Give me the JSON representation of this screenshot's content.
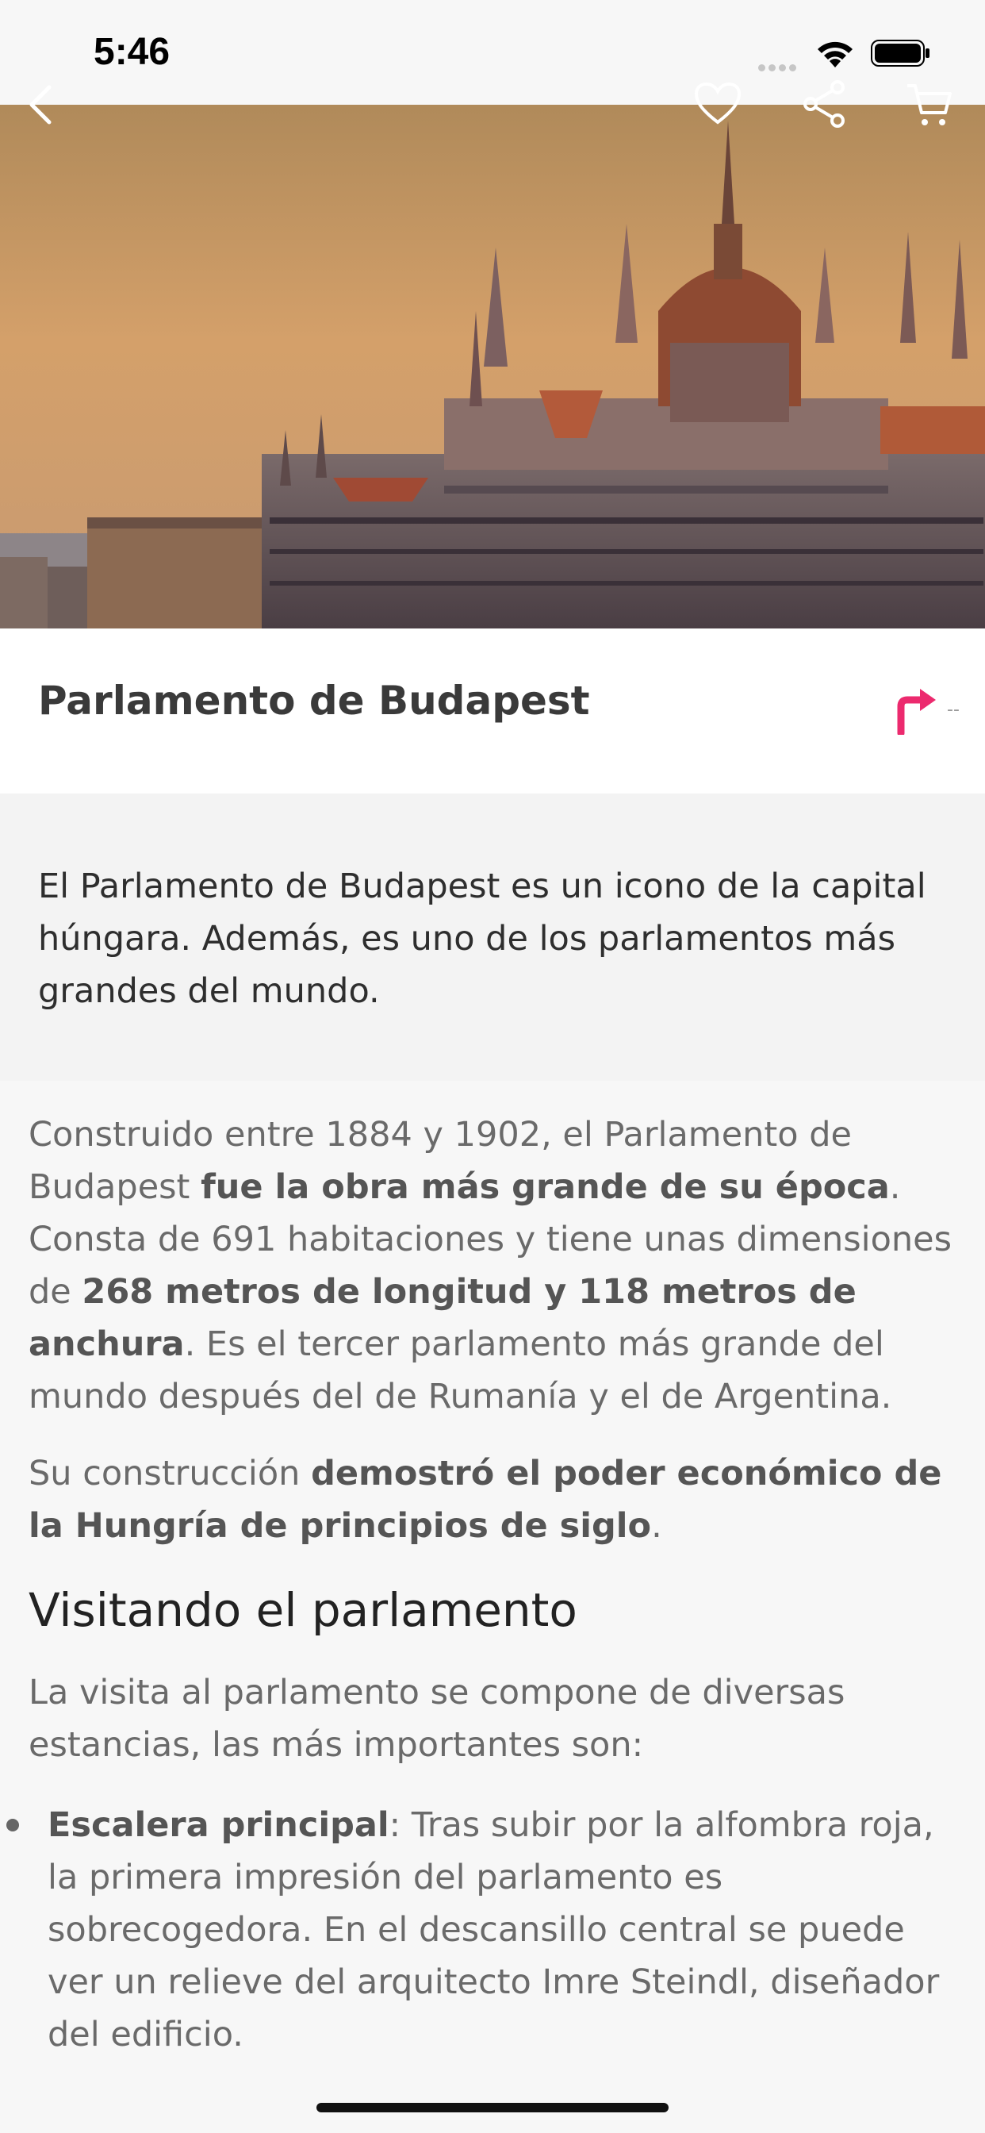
{
  "status": {
    "time": "5:46"
  },
  "place": {
    "title": "Parlamento de Budapest",
    "distance": "--",
    "intro": "El Parlamento de Budapest es un icono de la capital húngara. Además, es uno de los parlamentos más grandes del mundo."
  },
  "article": {
    "p1_a": "Construido entre 1884 y 1902, el Parlamento de Budapest ",
    "p1_b": "fue la obra más grande de su época",
    "p1_c": ". Consta de 691 habitaciones y tiene unas dimensiones de ",
    "p1_d": "268 metros de longitud y 118 metros de anchura",
    "p1_e": ". Es el tercer parlamento más grande del mundo después del de Rumanía y el de Argentina.",
    "p2_a": "Su construcción ",
    "p2_b": "demostró el poder económico de la Hungría de principios de siglo",
    "p2_c": ".",
    "h2": "Visitando el parlamento",
    "p3": "La visita al parlamento se compone de diversas estancias, las más importantes son:",
    "bullet_title": "Escalera principal",
    "bullet_text": ": Tras subir por la alfombra roja, la primera impresión del parlamento es sobrecogedora. En el descansillo central se puede ver un relieve del arquitecto Imre Steindl, diseñador del edificio."
  },
  "icons": {
    "back": "chevron-left-icon",
    "favorite": "heart-icon",
    "share": "share-icon",
    "cart": "cart-icon",
    "direction": "turn-right-arrow-icon"
  },
  "colors": {
    "accent": "#ec2a6e"
  }
}
